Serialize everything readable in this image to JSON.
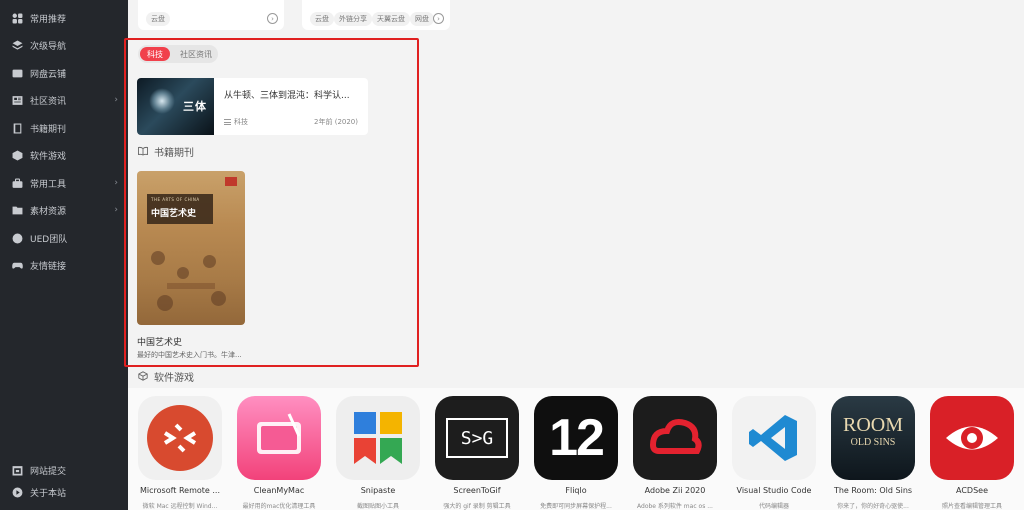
{
  "sidebar": {
    "items": [
      {
        "label": "常用推荐",
        "icon": "grid-icon",
        "has_arrow": false
      },
      {
        "label": "次级导航",
        "icon": "layers-icon",
        "has_arrow": false
      },
      {
        "label": "网盘云铺",
        "icon": "cloud-drive-icon",
        "has_arrow": false
      },
      {
        "label": "社区资讯",
        "icon": "newspaper-icon",
        "has_arrow": true
      },
      {
        "label": "书籍期刊",
        "icon": "book-icon",
        "has_arrow": false
      },
      {
        "label": "软件游戏",
        "icon": "cube-icon",
        "has_arrow": false
      },
      {
        "label": "常用工具",
        "icon": "toolbox-icon",
        "has_arrow": true
      },
      {
        "label": "素材资源",
        "icon": "folder-icon",
        "has_arrow": true
      },
      {
        "label": "UED团队",
        "icon": "ued-icon",
        "has_arrow": false
      },
      {
        "label": "友情链接",
        "icon": "gamepad-icon",
        "has_arrow": false
      }
    ],
    "bottom_items": [
      {
        "label": "网站提交",
        "icon": "submit-icon"
      },
      {
        "label": "关于本站",
        "icon": "play-circle-icon"
      }
    ],
    "arrow_glyph": "›"
  },
  "top_cards": {
    "card1": {
      "tags": [
        "云盘"
      ]
    },
    "card2": {
      "tags": [
        "云盘",
        "外链分享",
        "天翼云盘",
        "网盘"
      ]
    }
  },
  "community": {
    "tabs": [
      "科技",
      "社区资讯"
    ],
    "active_tab": "科技",
    "article": {
      "title": "从牛顿、三体到混沌：科学认...",
      "thumb_text": "三体",
      "category": "科技",
      "time": "2年前 (2020)"
    }
  },
  "books": {
    "heading": "书籍期刊",
    "item": {
      "title": "中国艺术史",
      "desc": "最好的中国艺术史入门书。牛津...",
      "cover_en": "THE ARTS OF CHINA",
      "cover_cn": "中国艺术史"
    }
  },
  "software": {
    "heading": "软件游戏",
    "apps": [
      {
        "name": "Microsoft Remote ...",
        "desc": "微软 Mac 远程控制 Wind...",
        "icon": "remote-desktop-icon"
      },
      {
        "name": "CleanMyMac",
        "desc": "最好用的mac优化清理工具",
        "icon": "cleanmymac-icon"
      },
      {
        "name": "Snipaste",
        "desc": "截图贴图小工具",
        "icon": "snipaste-icon"
      },
      {
        "name": "ScreenToGif",
        "desc": "强大的 gif 录制 剪辑工具",
        "icon": "screentogif-icon",
        "glyph": "S>G"
      },
      {
        "name": "Fliqlo",
        "desc": "免费即可同步屏幕保护程...",
        "icon": "fliqlo-icon",
        "glyph": "12"
      },
      {
        "name": "Adobe Zii 2020",
        "desc": "Adobe 系列软件 mac os ...",
        "icon": "adobe-cc-icon"
      },
      {
        "name": "Visual Studio Code",
        "desc": "代码编辑器",
        "icon": "vscode-icon"
      },
      {
        "name": "The Room: Old Sins",
        "desc": "你来了，你的好奇心驱使...",
        "icon": "the-room-icon",
        "glyph": "ROOM",
        "glyph2": "OLD SINS"
      },
      {
        "name": "ACDSee",
        "desc": "照片查看编辑管理工具",
        "icon": "acdsee-icon"
      }
    ]
  },
  "colors": {
    "accent": "#f1404b",
    "sidebar_bg": "#24272c",
    "highlight_box": "#e02020"
  }
}
